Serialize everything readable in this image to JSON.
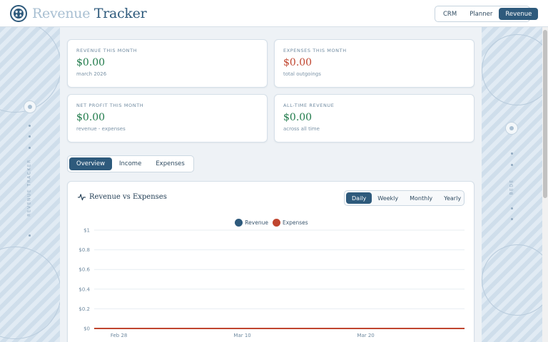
{
  "header": {
    "brand_light": "Revenue",
    "brand_dark": "Tracker",
    "nav": [
      {
        "label": "CRM",
        "active": false
      },
      {
        "label": "Planner",
        "active": false
      },
      {
        "label": "Revenue",
        "active": true
      }
    ]
  },
  "rails": {
    "left_text": "REVENUE TRACKER",
    "right_text": "BEDE"
  },
  "stats": [
    {
      "label": "REVENUE THIS MONTH",
      "value": "$0.00",
      "sub": "march 2026",
      "tone": "green"
    },
    {
      "label": "EXPENSES THIS MONTH",
      "value": "$0.00",
      "sub": "total outgoings",
      "tone": "red"
    },
    {
      "label": "NET PROFIT THIS MONTH",
      "value": "$0.00",
      "sub": "revenue - expenses",
      "tone": "green"
    },
    {
      "label": "ALL-TIME REVENUE",
      "value": "$0.00",
      "sub": "across all time",
      "tone": "green"
    }
  ],
  "tabs": [
    {
      "label": "Overview",
      "active": true
    },
    {
      "label": "Income",
      "active": false
    },
    {
      "label": "Expenses",
      "active": false
    }
  ],
  "chart_panel": {
    "title": "Revenue vs Expenses",
    "icon": "activity-icon",
    "periods": [
      {
        "label": "Daily",
        "active": true
      },
      {
        "label": "Weekly",
        "active": false
      },
      {
        "label": "Monthly",
        "active": false
      },
      {
        "label": "Yearly",
        "active": false
      }
    ]
  },
  "colors": {
    "revenue": "#2e5a7c",
    "expenses": "#c0452f",
    "accent": "#2e5a7c"
  },
  "chart_data": {
    "type": "line",
    "title": "Revenue vs Expenses",
    "xlabel": "",
    "ylabel": "",
    "ylim": [
      0,
      1
    ],
    "y_ticks": [
      "$0",
      "$0.2",
      "$0.4",
      "$0.6",
      "$0.8",
      "$1"
    ],
    "x_tick_labels": [
      "Feb 28",
      "Mar 10",
      "Mar 20"
    ],
    "grid": true,
    "legend_placement": "top-center",
    "series": [
      {
        "name": "Revenue",
        "color": "#2e5a7c",
        "values": [
          0,
          0,
          0,
          0,
          0,
          0,
          0,
          0,
          0,
          0,
          0,
          0,
          0,
          0,
          0,
          0,
          0,
          0,
          0,
          0,
          0,
          0,
          0,
          0,
          0,
          0,
          0,
          0,
          0,
          0,
          0
        ]
      },
      {
        "name": "Expenses",
        "color": "#c0452f",
        "values": [
          0,
          0,
          0,
          0,
          0,
          0,
          0,
          0,
          0,
          0,
          0,
          0,
          0,
          0,
          0,
          0,
          0,
          0,
          0,
          0,
          0,
          0,
          0,
          0,
          0,
          0,
          0,
          0,
          0,
          0,
          0
        ]
      }
    ]
  }
}
